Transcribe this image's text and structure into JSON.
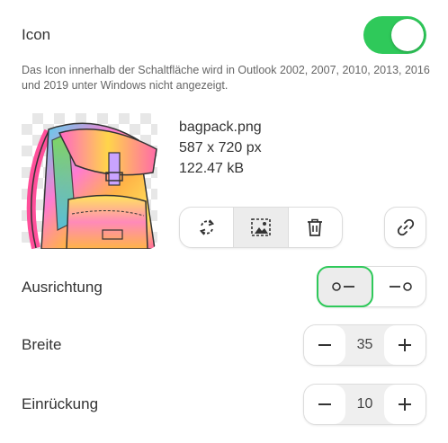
{
  "icon_section": {
    "label": "Icon",
    "toggle_on": true,
    "note": "Das Icon innerhalb der Schaltfläche wird in Outlook 2002, 2007, 2010, 2013, 2016 und 2019 unter Windows nicht angezeigt."
  },
  "file": {
    "name": "bagpack.png",
    "dimensions": "587 x 720 px",
    "size": "122.47 kB"
  },
  "actions": {
    "icons": [
      "replace-icon",
      "crop-image-icon",
      "trash-icon",
      "link-icon"
    ],
    "active": "crop-image-icon"
  },
  "alignment": {
    "label": "Ausrichtung",
    "options": [
      "icon-left",
      "icon-right"
    ],
    "selected": "icon-left"
  },
  "width": {
    "label": "Breite",
    "value": "35"
  },
  "indent": {
    "label": "Einrückung",
    "value": "10"
  },
  "colors": {
    "accent": "#2fc95a",
    "border": "#dcdcdc",
    "text": "#333333",
    "muted": "#666666"
  }
}
